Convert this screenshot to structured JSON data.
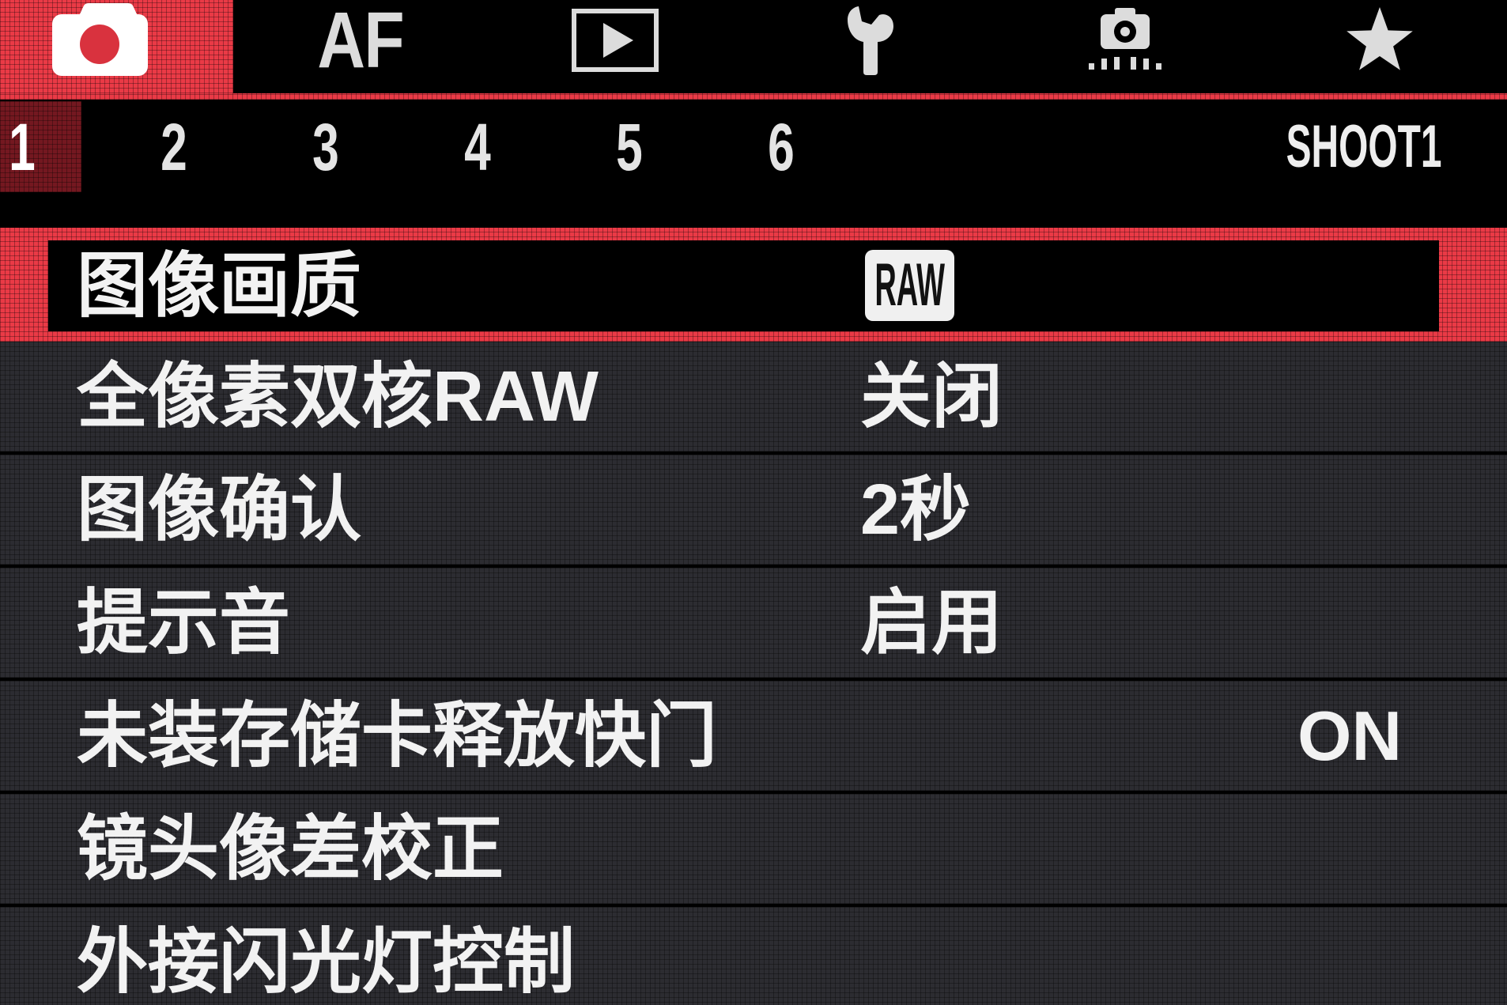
{
  "tabs": [
    {
      "icon": "camera-icon",
      "selected": true
    },
    {
      "label": "AF"
    },
    {
      "icon": "playback-icon"
    },
    {
      "icon": "wrench-icon"
    },
    {
      "icon": "custom-functions-icon"
    },
    {
      "icon": "star-icon"
    }
  ],
  "page_tabs": [
    {
      "label": "1",
      "selected": true
    },
    {
      "label": "2"
    },
    {
      "label": "3"
    },
    {
      "label": "4"
    },
    {
      "label": "5"
    },
    {
      "label": "6"
    }
  ],
  "page_name": "SHOOT1",
  "menu": {
    "items": [
      {
        "label": "图像画质",
        "badge": "RAW",
        "selected": true
      },
      {
        "label": "全像素双核RAW",
        "value": "关闭"
      },
      {
        "label": "图像确认",
        "value": "2秒"
      },
      {
        "label": "提示音",
        "value": "启用"
      },
      {
        "label": "未装存储卡释放快门",
        "value": "ON"
      },
      {
        "label": "镜头像差校正"
      },
      {
        "label": "外接闪光灯控制"
      }
    ]
  },
  "colors": {
    "selection_red": "#ea3a46",
    "selected_page_bg": "#741820",
    "row_background": "#2c2c31",
    "text": "#f2f2f2",
    "badge_background": "#f0f0f0"
  }
}
